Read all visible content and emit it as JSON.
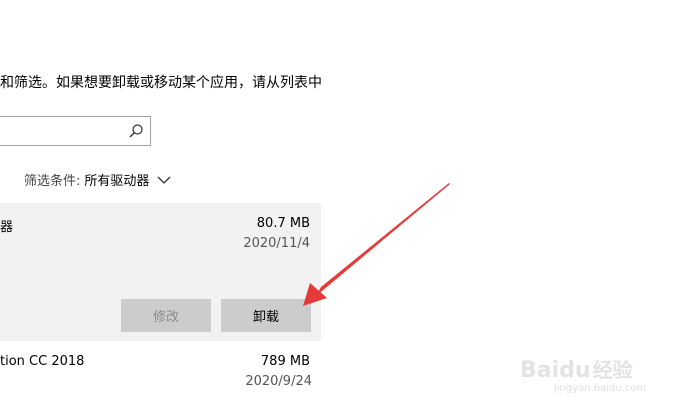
{
  "description": "和筛选。如果想要卸载或移动某个应用，请从列表中",
  "search": {
    "value": "",
    "placeholder": ""
  },
  "filter": {
    "label": "筛选条件:",
    "value": "所有驱动器"
  },
  "apps": [
    {
      "name": "器",
      "size": "80.7 MB",
      "date": "2020/11/4",
      "selected": true
    },
    {
      "name": "tion CC 2018",
      "size": "789 MB",
      "date": "2020/9/24",
      "selected": false
    }
  ],
  "buttons": {
    "modify": "修改",
    "uninstall": "卸载"
  },
  "annotation": {
    "arrow_color": "#e8393a"
  },
  "watermark": {
    "brand": "Baidu",
    "brand_cn": "经验",
    "url": "jingyan.baidu.com"
  }
}
